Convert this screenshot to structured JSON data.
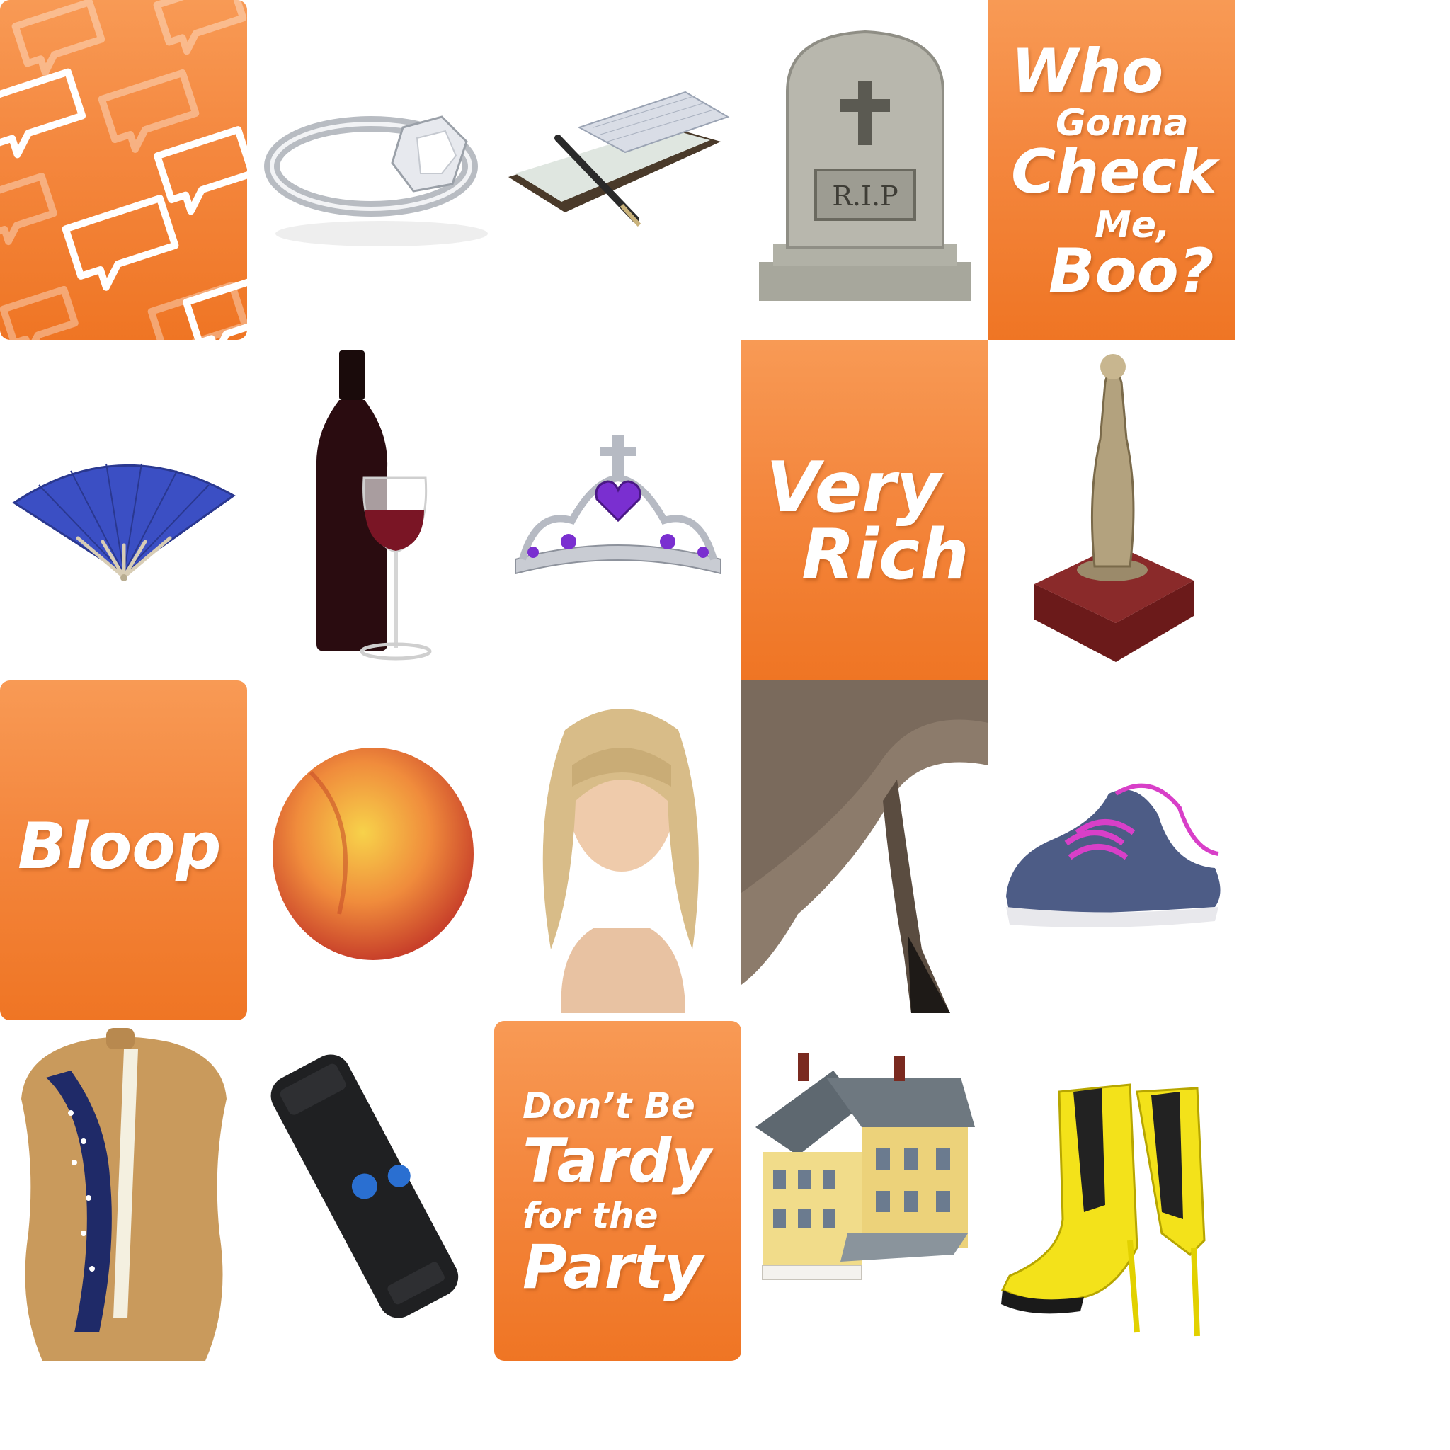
{
  "tiles": {
    "who_gonna_check": {
      "line1": "Who",
      "line2": "Gonna",
      "line3": "Check",
      "line4": "Me,",
      "line5": "Boo?"
    },
    "very_rich": {
      "line1": "Very",
      "line2": "Rich"
    },
    "bloop": {
      "line1": "Bloop"
    },
    "dont_be_tardy": {
      "line1": "Don’t Be",
      "line2": "Tardy",
      "line3": "for the",
      "line4": "Party"
    },
    "tombstone": {
      "engraving": "R.I.P"
    }
  },
  "objects": [
    {
      "icon": "speech-bubble-pattern-icon"
    },
    {
      "icon": "diamond-ring-icon"
    },
    {
      "icon": "checkbook-icon"
    },
    {
      "icon": "tombstone-icon"
    },
    {
      "icon": "hand-fan-icon"
    },
    {
      "icon": "wine-bottle-icon"
    },
    {
      "icon": "tiara-icon"
    },
    {
      "icon": "trophy-icon"
    },
    {
      "icon": "peach-icon"
    },
    {
      "icon": "wig-icon"
    },
    {
      "icon": "donkey-tail-icon"
    },
    {
      "icon": "sneakers-icon"
    },
    {
      "icon": "dress-form-icon"
    },
    {
      "icon": "taser-icon"
    },
    {
      "icon": "house-icon"
    },
    {
      "icon": "yellow-boots-icon"
    }
  ],
  "colors": {
    "orange_top": "#f89a55",
    "orange_bottom": "#ef7524",
    "text": "#ffffff",
    "fan_blue": "#3b4fc4",
    "wine": "#6e1020",
    "tiara_gem": "#7a2fd0",
    "boot_yellow": "#f3e21a",
    "sneaker_navy": "#4d5c86",
    "sneaker_lace": "#d83fc8"
  }
}
